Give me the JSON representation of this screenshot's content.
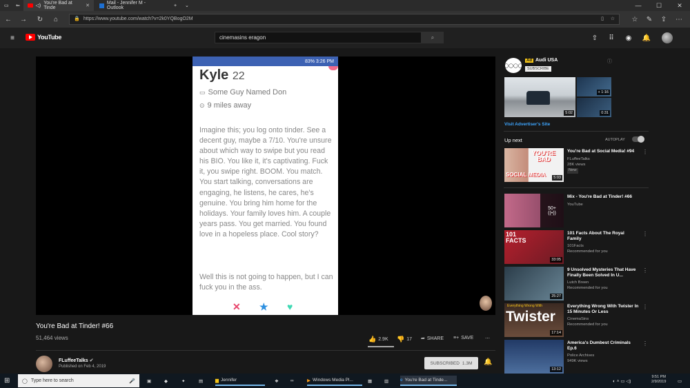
{
  "browser": {
    "tabs": [
      {
        "title": "You're Bad at Tinde",
        "active": true
      },
      {
        "title": "Mail - Jennifer M - Outlook",
        "active": false
      }
    ],
    "url": "https://www.youtube.com/watch?v=2k0YQBogO2M"
  },
  "header": {
    "logo": "YouTube",
    "search_value": "cinemasins eragon"
  },
  "video": {
    "phone_status": "83%  3:26 PM",
    "profile_name": "Kyle",
    "profile_age": "22",
    "profile_job": "Some Guy Named Don",
    "profile_distance": "9 miles away",
    "bio": "Imagine this; you log onto tinder. See a decent guy, maybe a 7/10. You're unsure about which way to swipe but you read his BIO. You like it, it's captivating. Fuck it, you swipe right. BOOM. You match. You start talking, conversations are engaging, he listens, he cares, he's genuine. You bring him home for the holidays. Your family loves him. A couple years pass. You get married. You found love in a hopeless place. Cool story?",
    "bio2": "Well this is not going to happen, but I can fuck you in the ass.",
    "title": "You're Bad at Tinder! #66",
    "views": "51,464 views",
    "likes": "2.9K",
    "dislikes": "17",
    "share_label": "SHARE",
    "save_label": "SAVE",
    "channel_name": "FLuffeeTalks",
    "published": "Published on Feb 4, 2019",
    "subscribed_label": "SUBSCRIBED",
    "subscriber_count": "1.3M"
  },
  "sidebar": {
    "ad_badge": "Ad",
    "ad_channel": "Audi USA",
    "ad_subscribe": "SUBSCRIBE",
    "ad_time_a": "+ 1:16",
    "ad_time_b": "5:02",
    "ad_time_c": "0:31",
    "ad_link": "Visit Advertiser's Site",
    "up_next": "Up next",
    "autoplay": "AUTOPLAY",
    "items": [
      {
        "title": "You're Bad at Social Media! #94",
        "channel": "FLuffeeTalks",
        "meta1": "28K views",
        "meta2": "New",
        "duration": "5:03"
      },
      {
        "title": "Mix - You're Bad at Tinder! #66",
        "channel": "YouTube",
        "meta1": "",
        "meta2": "",
        "duration": "50+"
      },
      {
        "title": "101 Facts About The Royal Family",
        "channel": "101Facts",
        "meta1": "Recommended for you",
        "meta2": "",
        "duration": "33:05"
      },
      {
        "title": "9 Unsolved Mysteries That Have Finally Been Solved In U...",
        "channel": "Lutch Breen",
        "meta1": "Recommended for you",
        "meta2": "",
        "duration": "25:27"
      },
      {
        "title": "Everything Wrong With Twister In 15 Minutes Or Less",
        "channel": "CinemaSins",
        "meta1": "Recommended for you",
        "meta2": "",
        "duration": "17:14"
      },
      {
        "title": "America's Dumbest Criminals Ep.6",
        "channel": "Police Archives",
        "meta1": "949K views",
        "meta2": "",
        "duration": "13:12"
      }
    ],
    "thumb_text_a": "YOU'RE BAD",
    "thumb_text_b": "SOCIAL MEDIA",
    "thumb_text_c": "101 FACTS",
    "thumb_text_d": "Twister",
    "thumb_text_e": "Everything Wrong With"
  },
  "taskbar": {
    "search_placeholder": "Type here to search",
    "items": [
      "Jennifer",
      "Windows Media Pl...",
      "You're Bad at Tinde..."
    ],
    "time": "9:51 PM",
    "date": "2/9/2019"
  }
}
